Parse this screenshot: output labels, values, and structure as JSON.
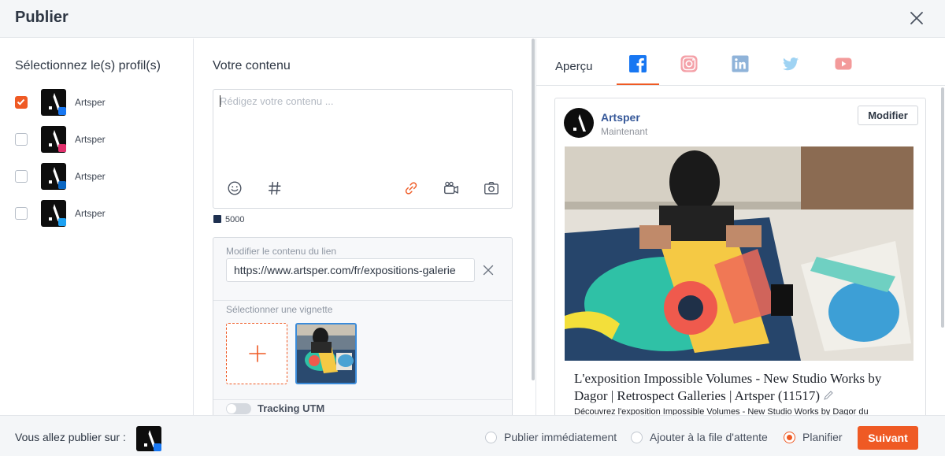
{
  "dialog": {
    "title": "Publier"
  },
  "profiles": {
    "heading": "Sélectionnez le(s) profil(s)",
    "items": [
      {
        "name": "Artsper",
        "network": "facebook-icon",
        "checked": true
      },
      {
        "name": "Artsper",
        "network": "instagram-icon",
        "checked": false
      },
      {
        "name": "Artsper",
        "network": "linkedin-icon",
        "checked": false
      },
      {
        "name": "Artsper",
        "network": "twitter-icon",
        "checked": false
      }
    ]
  },
  "content": {
    "heading": "Votre contenu",
    "placeholder": "Rédigez votre contenu ...",
    "char_count": "5000",
    "link_label": "Modifier le contenu du lien",
    "link_url": "https://www.artsper.com/fr/expositions-galerie",
    "thumbnail_label": "Sélectionner une vignette",
    "utm_label": "Tracking UTM"
  },
  "preview": {
    "tab_label": "Aperçu",
    "networks": [
      "facebook-icon",
      "instagram-icon",
      "linkedin-icon",
      "twitter-icon",
      "youtube-icon"
    ],
    "profile_name": "Artsper",
    "time": "Maintenant",
    "modify_label": "Modifier",
    "link_title": "L'exposition Impossible Volumes - New Studio Works by Dagor | Retrospect Galleries | Artsper (11517)",
    "link_description": "Découvrez l'exposition Impossible Volumes - New Studio Works by Dagor du"
  },
  "footer": {
    "publish_on_label": "Vous allez publier sur :",
    "options": [
      {
        "label": "Publier immédiatement",
        "selected": false
      },
      {
        "label": "Ajouter à la file d'attente",
        "selected": false
      },
      {
        "label": "Planifier",
        "selected": true
      }
    ],
    "next_label": "Suivant"
  },
  "colors": {
    "accent": "#ef5a24",
    "facebook": "#1877f2",
    "link_blue": "#365899"
  }
}
